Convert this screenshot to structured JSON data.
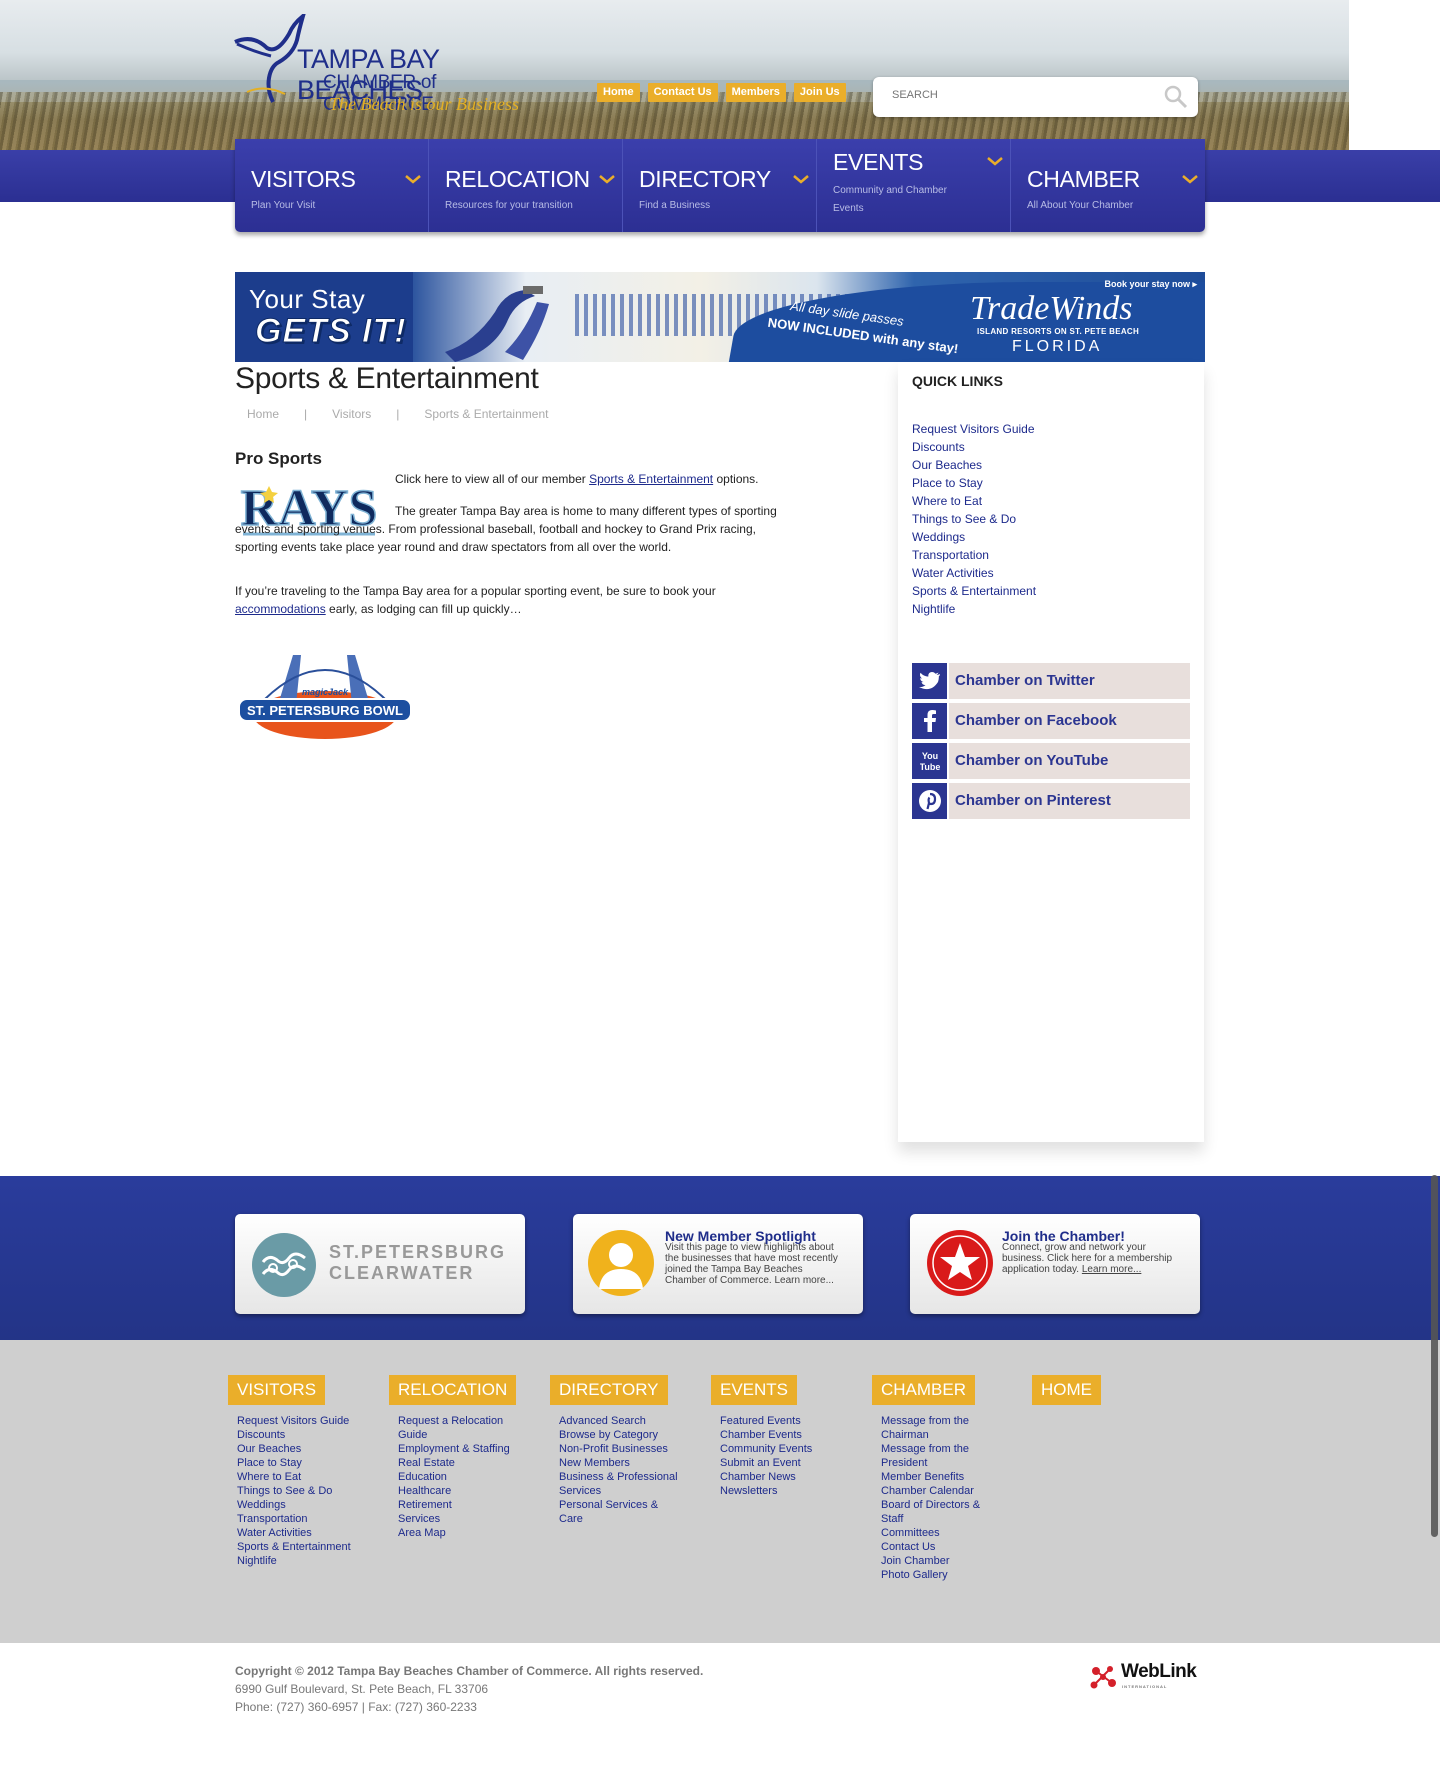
{
  "header": {
    "logo": {
      "line1": "TAMPA BAY BEACHES",
      "line2": "CHAMBER of COMMERCE",
      "tagline": "The Beach is our Business"
    },
    "toplinks": [
      "Home",
      "Contact Us",
      "Members",
      "Join Us"
    ],
    "search": {
      "placeholder": "SEARCH"
    }
  },
  "nav": [
    {
      "title": "VISITORS",
      "subtitle": "Plan Your Visit"
    },
    {
      "title": "RELOCATION",
      "subtitle": "Resources for your transition"
    },
    {
      "title": "DIRECTORY",
      "subtitle": "Find a Business"
    },
    {
      "title": "EVENTS",
      "subtitle": "Community and Chamber Events"
    },
    {
      "title": "CHAMBER",
      "subtitle": "All About Your Chamber"
    }
  ],
  "banner": {
    "headline1": "Your Stay",
    "headline2": "GETS IT!",
    "line1": "All day slide passes",
    "line2": "NOW INCLUDED with any stay!",
    "brand": "TradeWinds",
    "brand_sub": "ISLAND RESORTS ON ST. PETE BEACH",
    "brand_loc": "FLORIDA",
    "cta": "Book your stay now ▸"
  },
  "page": {
    "title": "Sports & Entertainment",
    "breadcrumb": [
      "Home",
      "Visitors",
      "Sports & Entertainment"
    ],
    "section_heading": "Pro Sports",
    "rays_logo": "RAYS",
    "p1_before": "Click here to view all of our member ",
    "p1_link": "Sports & Entertainment",
    "p1_after": " options.",
    "p2": "The greater Tampa Bay area is home to many different types of sporting events and sporting venues. From professional baseball, football and hockey to Grand Prix racing, sporting events take place year round and draw spectators from all over the world.",
    "p3_before": "If you’re traveling to the Tampa Bay area for a popular sporting event, be sure to book your ",
    "p3_link": "accommodations",
    "p3_after": " early, as lodging can fill up quickly…",
    "bowl_text": "ST. PETERSBURG BOWL",
    "bowl_sponsor": "magicJack"
  },
  "sidebar": {
    "heading": "QUICK LINKS",
    "links": [
      "Request Visitors Guide",
      "Discounts",
      "Our Beaches",
      "Place to Stay",
      "Where to Eat",
      "Things to See & Do",
      "Weddings",
      "Transportation",
      "Water Activities",
      "Sports & Entertainment",
      "Nightlife"
    ],
    "social": [
      {
        "label": "Chamber on Twitter",
        "icon": "twitter-icon"
      },
      {
        "label": "Chamber on Facebook",
        "icon": "facebook-icon"
      },
      {
        "label": "Chamber on YouTube",
        "icon": "youtube-icon"
      },
      {
        "label": "Chamber on Pinterest",
        "icon": "pinterest-icon"
      }
    ]
  },
  "cards": {
    "stpete": {
      "line1": "ST.PETERSBURG",
      "line2": "CLEARWATER"
    },
    "spotlight": {
      "title": "New Member Spotlight",
      "desc": "Visit this page to view highlights about the businesses that have most recently joined the Tampa Bay Beaches Chamber of Commerce.",
      "more": "Learn more..."
    },
    "join": {
      "title": "Join the Chamber!",
      "desc": "Connect, grow and network your business. Click here for a membership application today.",
      "more": "Learn more..."
    }
  },
  "footer_nav": [
    {
      "title": "VISITORS",
      "links": [
        "Request Visitors Guide",
        "Discounts",
        "Our Beaches",
        "Place to Stay",
        "Where to Eat",
        "Things to See & Do",
        "Weddings",
        "Transportation",
        "Water Activities",
        "Sports & Entertainment",
        "Nightlife"
      ]
    },
    {
      "title": "RELOCATION",
      "links": [
        "Request a Relocation Guide",
        "Employment & Staffing",
        "Real Estate",
        "Education",
        "Healthcare",
        "Retirement",
        "Services",
        "Area Map"
      ]
    },
    {
      "title": "DIRECTORY",
      "links": [
        "Advanced Search",
        "Browse by Category",
        "Non-Profit Businesses",
        "New Members",
        "Business & Professional Services",
        "Personal Services & Care"
      ]
    },
    {
      "title": "EVENTS",
      "links": [
        "Featured Events",
        "Chamber Events",
        "Community Events",
        "Submit an Event",
        "Chamber News",
        "Newsletters"
      ]
    },
    {
      "title": "CHAMBER",
      "links": [
        "Message from the Chairman",
        "Message from the President",
        "Member Benefits",
        "Chamber Calendar",
        "Board of Directors & Staff",
        "Committees",
        "Contact Us",
        "Join Chamber",
        "Photo Gallery"
      ]
    },
    {
      "title": "HOME",
      "links": []
    }
  ],
  "bottom": {
    "copyright": "Copyright © 2012 Tampa Bay Beaches Chamber of Commerce.  All rights reserved.",
    "address": "6990 Gulf Boulevard, St. Pete Beach, FL 33706",
    "phone": "Phone: (727) 360-6957 | Fax: (727) 360-2233",
    "weblink": "WebLink",
    "weblink_sub": "INTERNATIONAL"
  },
  "colors": {
    "navy": "#2b2f92",
    "gold": "#eaae2a",
    "link": "#1d2a8c",
    "footer_gray": "#cfcfcf"
  }
}
